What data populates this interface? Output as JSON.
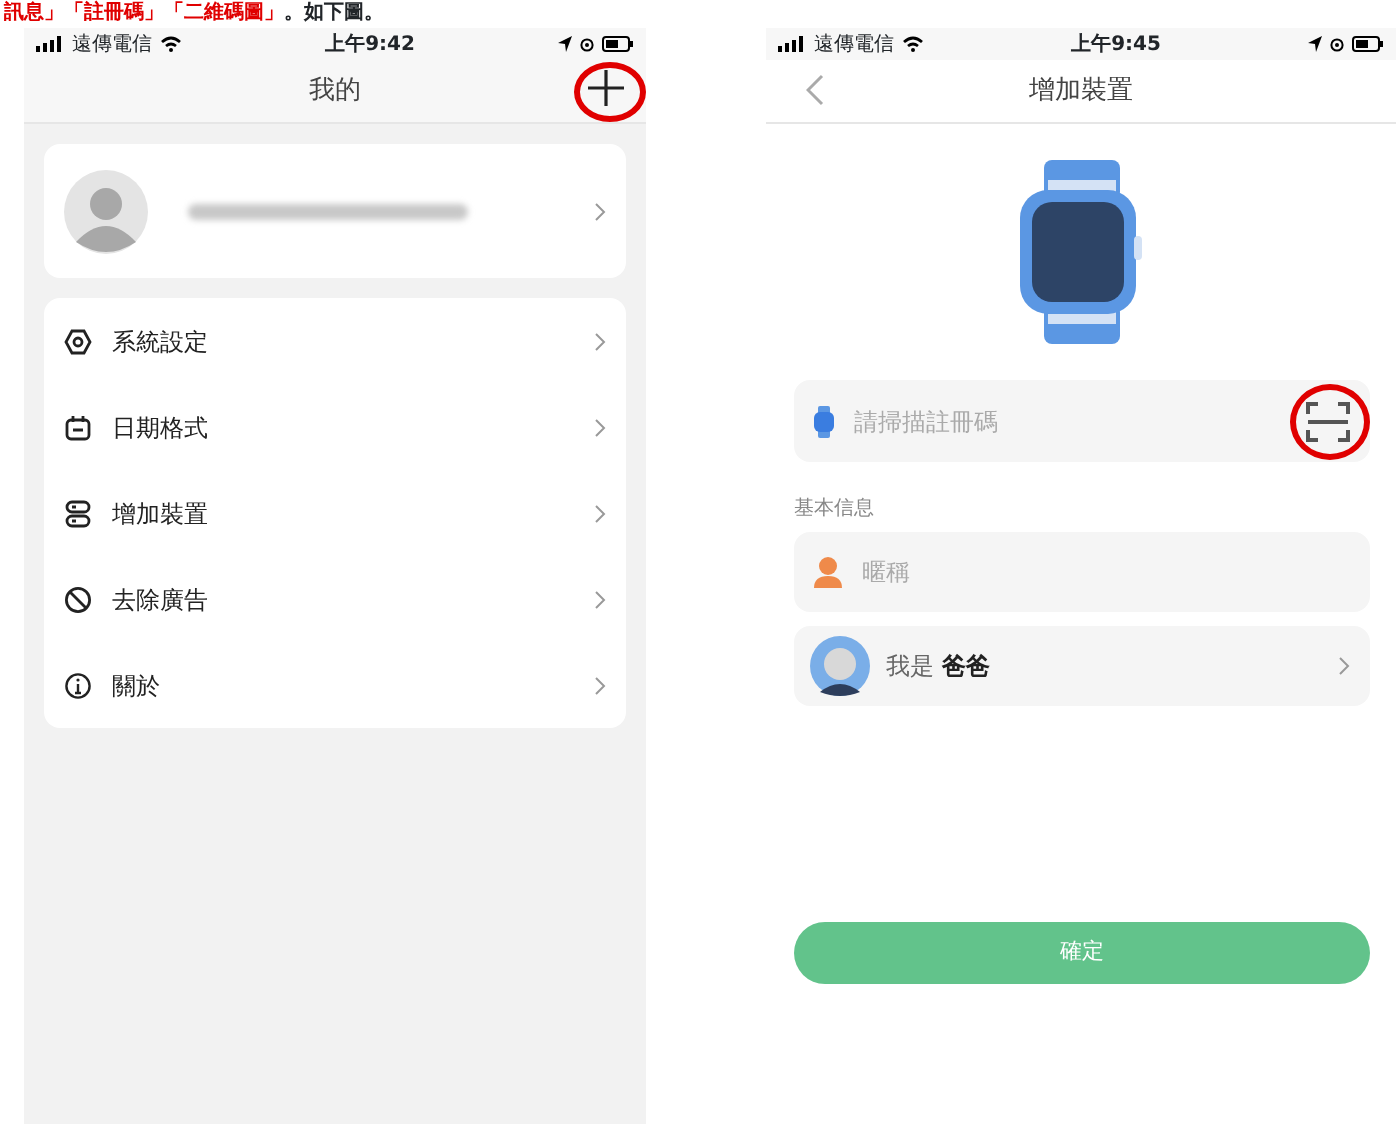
{
  "caption": [
    {
      "text": "訊息」「註冊碼」「二維碼圖」",
      "emphasis": true
    },
    {
      "text": "。如下圖。",
      "emphasis": false
    }
  ],
  "left_screen": {
    "status_bar": {
      "carrier": "遠傳電信",
      "time": "上午9:42"
    },
    "title": "我的",
    "add_button": {
      "annotated": true
    },
    "menu": [
      {
        "label": "系統設定",
        "kind": "settings"
      },
      {
        "label": "日期格式",
        "kind": "calendar"
      },
      {
        "label": "增加裝置",
        "kind": "device"
      },
      {
        "label": "去除廣告",
        "kind": "noads"
      },
      {
        "label": "關於",
        "kind": "info"
      }
    ]
  },
  "right_screen": {
    "status_bar": {
      "carrier": "遠傳電信",
      "time": "上午9:45"
    },
    "title": "增加裝置",
    "scan_field": {
      "placeholder": "請掃描註冊碼",
      "annotated": true
    },
    "section_label": "基本信息",
    "nickname_field": {
      "placeholder": "暱稱"
    },
    "relation": {
      "prefix": "我是",
      "value": "爸爸"
    },
    "confirm_button": "確定"
  }
}
